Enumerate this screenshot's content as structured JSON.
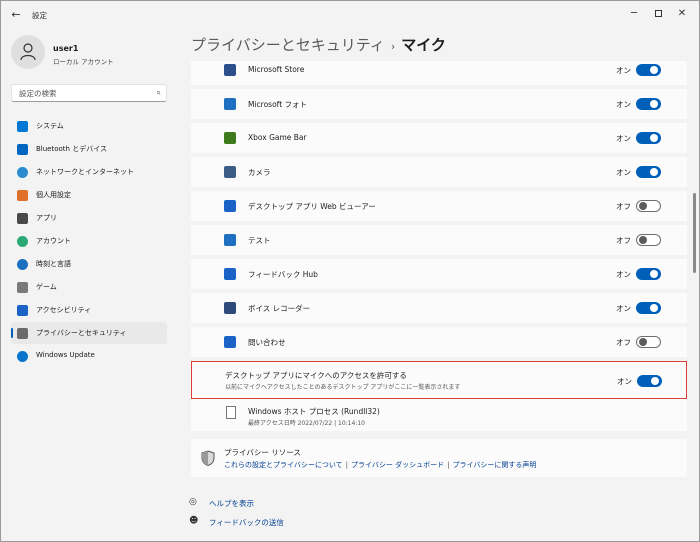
{
  "window": {
    "title": "設定"
  },
  "profile": {
    "name": "user1",
    "account_type": "ローカル アカウント"
  },
  "search": {
    "placeholder": "設定の検索"
  },
  "sidebar": {
    "items": [
      {
        "label": "システム",
        "icon": "monitor-icon",
        "color": "#0078d4"
      },
      {
        "label": "Bluetooth とデバイス",
        "icon": "bluetooth-icon",
        "color": "#0067c0"
      },
      {
        "label": "ネットワークとインターネット",
        "icon": "wifi-icon",
        "color": "#2a8ccf"
      },
      {
        "label": "個人用設定",
        "icon": "brush-icon",
        "color": "#e0712c"
      },
      {
        "label": "アプリ",
        "icon": "apps-icon",
        "color": "#4a4a4a"
      },
      {
        "label": "アカウント",
        "icon": "person-icon",
        "color": "#2aa876"
      },
      {
        "label": "時刻と言語",
        "icon": "globe-clock-icon",
        "color": "#1a6fbf"
      },
      {
        "label": "ゲーム",
        "icon": "gamepad-icon",
        "color": "#7a7a7a"
      },
      {
        "label": "アクセシビリティ",
        "icon": "accessibility-icon",
        "color": "#1b63c6"
      },
      {
        "label": "プライバシーとセキュリティ",
        "icon": "shield-icon",
        "color": "#6b6b6b",
        "active": true
      },
      {
        "label": "Windows Update",
        "icon": "update-icon",
        "color": "#0a73cc"
      }
    ]
  },
  "header": {
    "parent": "プライバシーとセキュリティ",
    "separator": "›",
    "current": "マイク"
  },
  "apps": [
    {
      "name": "Microsoft Store",
      "icon": "store-icon",
      "color": "#2a4f8a",
      "state": "オン",
      "on": true
    },
    {
      "name": "Microsoft フォト",
      "icon": "photos-icon",
      "color": "#1e6fc2",
      "state": "オン",
      "on": true
    },
    {
      "name": "Xbox Game Bar",
      "icon": "xbox-icon",
      "color": "#3c7a1c",
      "state": "オン",
      "on": true
    },
    {
      "name": "カメラ",
      "icon": "camera-icon",
      "color": "#3b5d85",
      "state": "オン",
      "on": true
    },
    {
      "name": "デスクトップ アプリ Web ビューアー",
      "icon": "webview-icon",
      "color": "#1b63c6",
      "state": "オフ",
      "on": false
    },
    {
      "name": "テスト",
      "icon": "calculator-icon",
      "color": "#1e6fc2",
      "state": "オフ",
      "on": false
    },
    {
      "name": "フィードバック Hub",
      "icon": "feedback-icon",
      "color": "#1b63c6",
      "state": "オン",
      "on": true
    },
    {
      "name": "ボイス レコーダー",
      "icon": "recorder-icon",
      "color": "#2d4a7a",
      "state": "オン",
      "on": true
    },
    {
      "name": "問い合わせ",
      "icon": "help-icon",
      "color": "#1b63c6",
      "state": "オフ",
      "on": false
    }
  ],
  "desktop_access": {
    "title": "デスクトップ アプリにマイクへのアクセスを許可する",
    "subtitle": "以前にマイクへアクセスしたことのあるデスクトップ アプリがここに一覧表示されます",
    "state": "オン",
    "on": true
  },
  "host": {
    "name": "Windows ホスト プロセス (Rundll32)",
    "last_access": "最終アクセス日時 2022/07/22 | 10:14:10"
  },
  "privacy_resources": {
    "title": "プライバシー リソース",
    "links": [
      "これらの設定とプライバシーについて",
      "プライバシー ダッシュボード",
      "プライバシーに関する声明"
    ]
  },
  "help": {
    "help_label": "ヘルプを表示",
    "feedback_label": "フィードバックの送信"
  }
}
